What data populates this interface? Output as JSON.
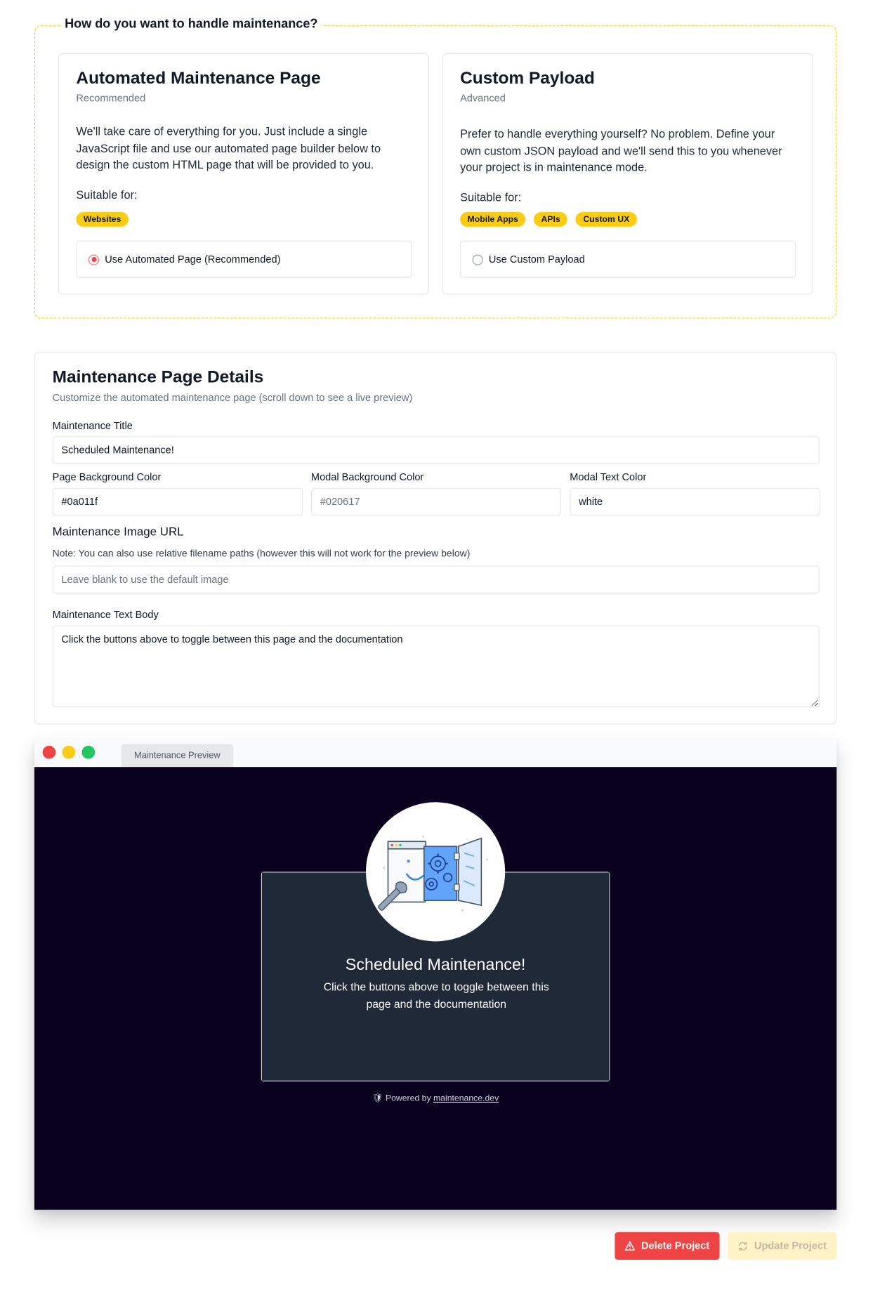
{
  "mode_section": {
    "legend": "How do you want to handle maintenance?",
    "automated": {
      "title": "Automated Maintenance Page",
      "subtitle": "Recommended",
      "description": "We'll take care of everything for you. Just include a single JavaScript file and use our automated page builder below to design the custom HTML page that will be provided to you.",
      "suitable_label": "Suitable for:",
      "tags": [
        "Websites"
      ],
      "option_label": "Use Automated Page (Recommended)",
      "selected": true
    },
    "custom": {
      "title": "Custom Payload",
      "subtitle": "Advanced",
      "description": "Prefer to handle everything yourself? No problem. Define your own custom JSON payload and we'll send this to you whenever your project is in maintenance mode.",
      "suitable_label": "Suitable for:",
      "tags": [
        "Mobile Apps",
        "APIs",
        "Custom UX"
      ],
      "option_label": "Use Custom Payload",
      "selected": false
    }
  },
  "details": {
    "title": "Maintenance Page Details",
    "subtitle": "Customize the automated maintenance page (scroll down to see a live preview)",
    "maintenance_title": {
      "label": "Maintenance Title",
      "value": "Scheduled Maintenance!"
    },
    "page_bg": {
      "label": "Page Background Color",
      "value": "#0a011f"
    },
    "modal_bg": {
      "label": "Modal Background Color",
      "placeholder": "#020617"
    },
    "modal_text": {
      "label": "Modal Text Color",
      "value": "white"
    },
    "image_url": {
      "label": "Maintenance Image URL",
      "note": "Note: You can also use relative filename paths (however this will not work for the preview below)",
      "placeholder": "Leave blank to use the default image"
    },
    "text_body": {
      "label": "Maintenance Text Body",
      "value": "Click the buttons above to toggle between this page and the documentation"
    }
  },
  "preview": {
    "tab_label": "Maintenance Preview",
    "modal_title": "Scheduled Maintenance!",
    "modal_body": "Click the buttons above to toggle between this page and the documentation",
    "powered_prefix": "Powered by",
    "powered_link": "maintenance.dev",
    "icon": "maintenance-illustration"
  },
  "actions": {
    "delete_label": "Delete Project",
    "update_label": "Update Project"
  },
  "colors": {
    "accent": "#facc15",
    "danger": "#ef4444",
    "page_bg": "#0a011f",
    "modal_bg": "#1f2937"
  }
}
